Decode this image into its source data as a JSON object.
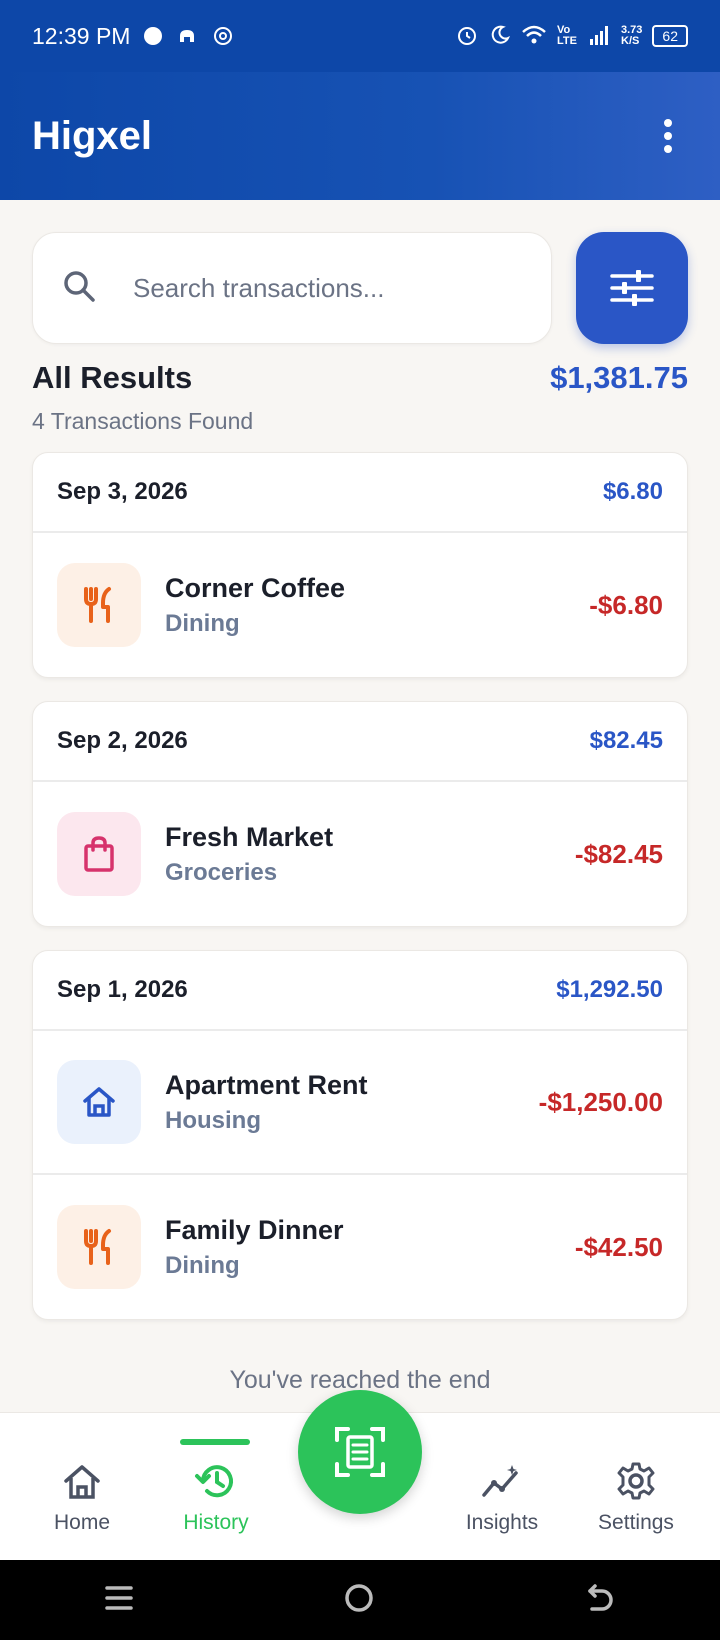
{
  "status_bar": {
    "time": "12:39 PM",
    "network_speed_top": "3.73",
    "network_speed_unit": "K/S",
    "network_type": "Vo LTE",
    "battery": "62"
  },
  "app_bar": {
    "title": "Higxel"
  },
  "search": {
    "placeholder": "Search transactions..."
  },
  "results": {
    "title": "All Results",
    "count": "4 Transactions Found",
    "total": "$1,381.75"
  },
  "groups": [
    {
      "date": "Sep 3, 2026",
      "total": "$6.80",
      "transactions": [
        {
          "name": "Corner Coffee",
          "category": "Dining",
          "amount": "-$6.80",
          "icon": "utensils-icon"
        }
      ]
    },
    {
      "date": "Sep 2, 2026",
      "total": "$82.45",
      "transactions": [
        {
          "name": "Fresh Market",
          "category": "Groceries",
          "amount": "-$82.45",
          "icon": "shopping-bag-icon"
        }
      ]
    },
    {
      "date": "Sep 1, 2026",
      "total": "$1,292.50",
      "transactions": [
        {
          "name": "Apartment Rent",
          "category": "Housing",
          "amount": "-$1,250.00",
          "icon": "house-icon"
        },
        {
          "name": "Family Dinner",
          "category": "Dining",
          "amount": "-$42.50",
          "icon": "utensils-icon"
        }
      ]
    }
  ],
  "end_message": "You've reached the end",
  "nav": {
    "home": "Home",
    "history": "History",
    "insights": "Insights",
    "settings": "Settings"
  },
  "colors": {
    "primary": "#2a56c6",
    "header": "#0d47a8",
    "accent_green": "#2cc35a",
    "expense_red": "#c62828",
    "dining_orange": "#e8621a",
    "groceries_pink": "#d6336c",
    "housing_blue": "#2a56c6"
  }
}
